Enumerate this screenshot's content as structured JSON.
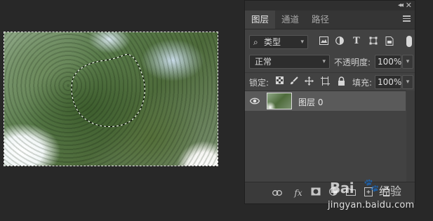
{
  "panel": {
    "tabs": [
      {
        "label": "图层",
        "active": true
      },
      {
        "label": "通道",
        "active": false
      },
      {
        "label": "路径",
        "active": false
      }
    ],
    "filter": {
      "value": "类型"
    },
    "blend_mode": {
      "value": "正常"
    },
    "opacity": {
      "label": "不透明度:",
      "value": "100%"
    },
    "lock": {
      "label": "锁定:"
    },
    "fill": {
      "label": "填充:",
      "value": "100%"
    },
    "layers": [
      {
        "name": "图层 0",
        "visible": true,
        "selected": true
      }
    ]
  },
  "watermark": {
    "logo": "Bai",
    "brand": "经验",
    "url": "jingyan.baidu.com"
  },
  "colors": {
    "background": "#282828",
    "panel": "#424242",
    "selected_layer": "#5a5a5a"
  }
}
